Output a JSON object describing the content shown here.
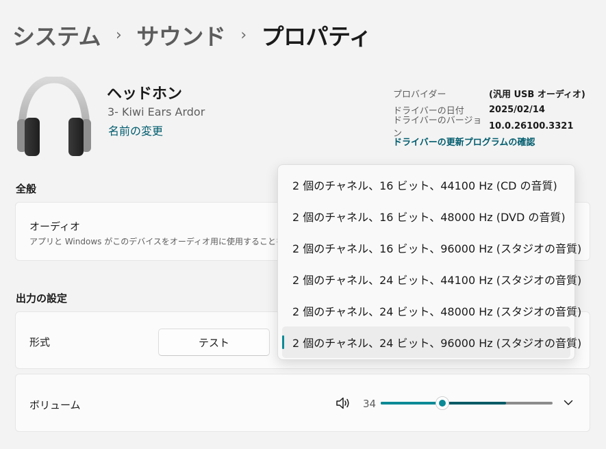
{
  "breadcrumb": {
    "items": [
      "システム",
      "サウンド",
      "プロパティ"
    ]
  },
  "device": {
    "name": "ヘッドホン",
    "model": "3- Kiwi Ears Ardor",
    "rename_link": "名前の変更"
  },
  "driver": {
    "rows": [
      {
        "key": "プロバイダー",
        "value": "(汎用 USB オーディオ)"
      },
      {
        "key": "ドライバーの日付",
        "value": "2025/02/14"
      },
      {
        "key": "ドライバーのバージョン",
        "value": "10.0.26100.3321"
      }
    ],
    "update_link": "ドライバーの更新プログラムの確認"
  },
  "general": {
    "title": "全般",
    "audio_label": "オーディオ",
    "audio_desc": "アプリと Windows がこのデバイスをオーディオ用に使用することを"
  },
  "output": {
    "title": "出力の設定",
    "format_label": "形式",
    "test_button": "テスト",
    "volume_label": "ボリューム",
    "volume_value": "34",
    "volume_level": 0.36,
    "volume_peak": 0.73
  },
  "format_dropdown": {
    "options": [
      "2 個のチャネル、16 ビット、44100 Hz (CD の音質)",
      "2 個のチャネル、16 ビット、48000 Hz (DVD の音質)",
      "2 個のチャネル、16 ビット、96000 Hz (スタジオの音質)",
      "2 個のチャネル、24 ビット、44100 Hz (スタジオの音質)",
      "2 個のチャネル、24 ビット、48000 Hz (スタジオの音質)",
      "2 個のチャネル、24 ビット、96000 Hz (スタジオの音質)"
    ],
    "selected_index": 5
  },
  "colors": {
    "accent": "#0a8a96",
    "link": "#005c6e",
    "background": "#f3f3f3",
    "card": "#fbfbfb"
  },
  "icons": [
    "headphones-icon",
    "speaker-icon",
    "chevron-down-icon",
    "chevron-right-icon"
  ]
}
